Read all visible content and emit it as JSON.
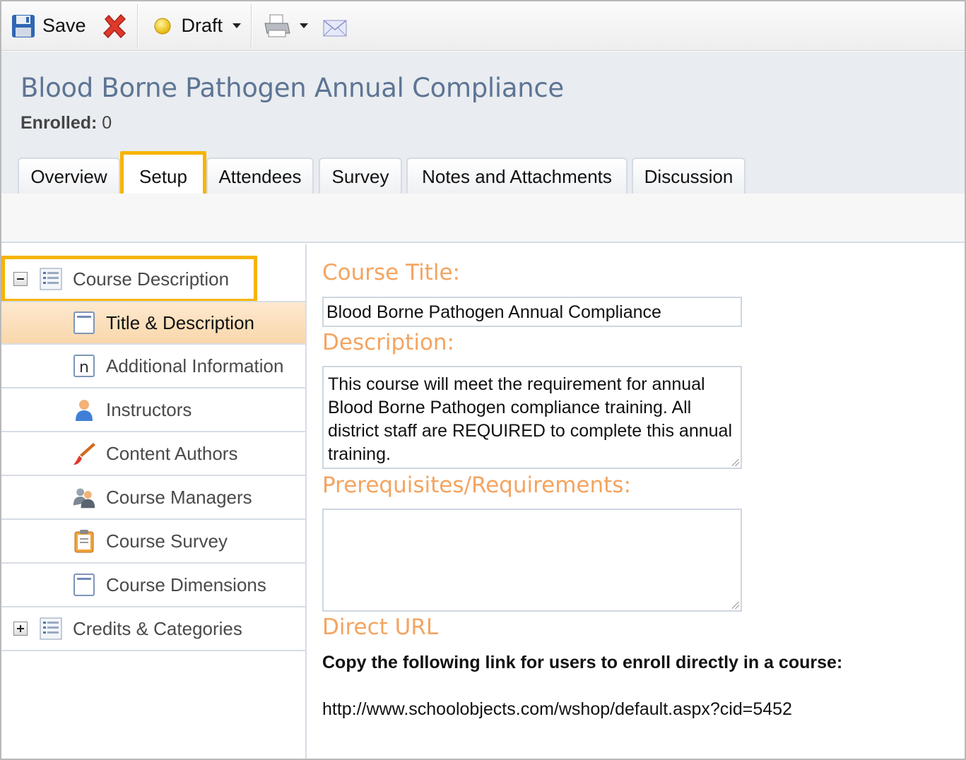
{
  "toolbar": {
    "save_label": "Save",
    "status_label": "Draft"
  },
  "header": {
    "title": "Blood Borne Pathogen Annual Compliance",
    "enrolled_label": "Enrolled:",
    "enrolled_value": "0"
  },
  "tabs": [
    {
      "label": "Overview"
    },
    {
      "label": "Setup"
    },
    {
      "label": "Attendees"
    },
    {
      "label": "Survey"
    },
    {
      "label": "Notes and Attachments"
    },
    {
      "label": "Discussion"
    }
  ],
  "active_tab": "Setup",
  "sidebar": {
    "items": [
      {
        "label": "Course Description",
        "icon": "list-icon",
        "expanded": true
      },
      {
        "label": "Title & Description",
        "icon": "document-icon",
        "selected": true
      },
      {
        "label": "Additional Information",
        "icon": "info-icon"
      },
      {
        "label": "Instructors",
        "icon": "person-icon"
      },
      {
        "label": "Content Authors",
        "icon": "paintbrush-icon"
      },
      {
        "label": "Course Managers",
        "icon": "managers-icon"
      },
      {
        "label": "Course Survey",
        "icon": "clipboard-icon"
      },
      {
        "label": "Course Dimensions",
        "icon": "document-icon"
      },
      {
        "label": "Credits & Categories",
        "icon": "list-icon",
        "expanded": false
      }
    ]
  },
  "form": {
    "course_title_label": "Course Title:",
    "course_title_value": "Blood Borne Pathogen Annual Compliance",
    "description_label": "Description:",
    "description_value": "This course will meet the requirement for annual Blood Borne Pathogen compliance training. All district staff are REQUIRED to complete this annual training.",
    "prereq_label": "Prerequisites/Requirements:",
    "prereq_value": "",
    "direct_url_label": "Direct URL",
    "direct_url_instructions": "Copy the following link for users to enroll directly in a course:",
    "direct_url": "http://www.schoolobjects.com/wshop/default.aspx?cid=5452"
  },
  "colors": {
    "title_blue": "#5d7594",
    "label_orange": "#f4a460",
    "highlight_yellow": "#f6b400",
    "selected_row": "#f9d7ab",
    "header_bg": "#e9ecf0"
  }
}
